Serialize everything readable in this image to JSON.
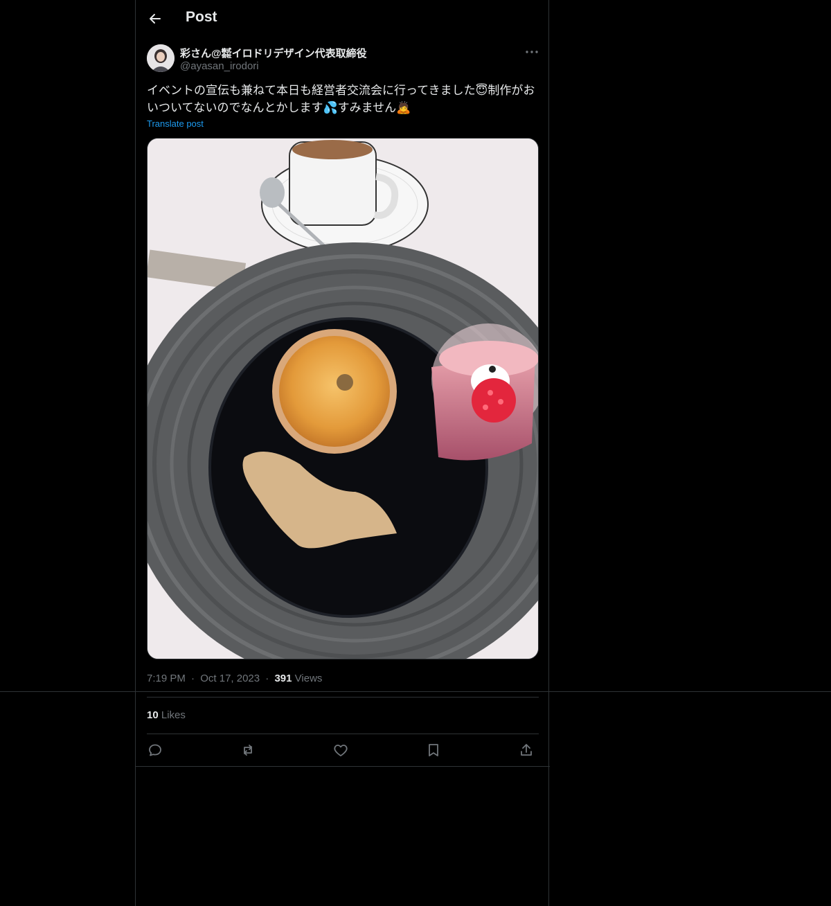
{
  "header": {
    "title": "Post"
  },
  "author": {
    "display_name": "彩さん@㍿イロドリデザイン代表取締役",
    "handle": "@ayasan_irodori"
  },
  "post": {
    "text_line1": "イベントの宣伝も兼ねて本日も経営者交流会に行ってきました😇制作がお",
    "text_line2": "いついてないのでなんとかします💦すみません🙇",
    "translate_label": "Translate post",
    "time": "7:19 PM",
    "date": "Oct 17, 2023",
    "views_count": "391",
    "views_label": "Views",
    "likes_count": "10",
    "likes_label": "Likes",
    "dot": "·"
  },
  "icons": {
    "back": "arrow-left-icon",
    "more": "more-horizontal-icon",
    "reply": "reply-icon",
    "repost": "repost-icon",
    "like": "heart-icon",
    "bookmark": "bookmark-icon",
    "share": "share-icon"
  },
  "colors": {
    "background": "#000000",
    "text": "#e7e9ea",
    "muted": "#71767b",
    "link": "#1d9bf0",
    "border": "#2f3336"
  }
}
